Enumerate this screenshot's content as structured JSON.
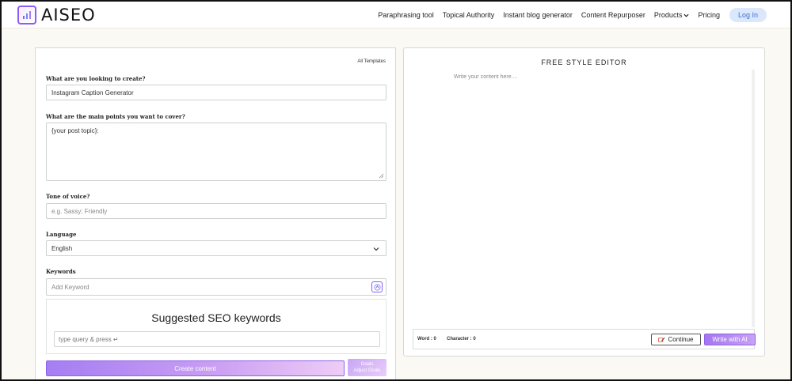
{
  "header": {
    "logo_text": "AISEO",
    "nav": [
      "Paraphrasing tool",
      "Topical Authority",
      "Instant blog generator",
      "Content Repurposer",
      "Products",
      "Pricing"
    ],
    "login_label": "Log In"
  },
  "form": {
    "all_templates": "All Templates",
    "create_label": "What are you looking to create?",
    "create_value": "Instagram Caption Generator",
    "points_label": "What are the main points you want to cover?",
    "points_value": "{your post topic}:",
    "tone_label": "Tone of voice?",
    "tone_placeholder": "e.g. Sassy; Friendly",
    "language_label": "Language",
    "language_value": "English",
    "keywords_label": "Keywords",
    "keywords_placeholder": "Add Keyword",
    "seo_title": "Suggested SEO keywords",
    "seo_placeholder": "type query & press ↵",
    "create_button": "Create content",
    "goals_line1": "Goals",
    "goals_line2": "Adjust Goals"
  },
  "editor": {
    "title": "FREE STYLE EDITOR",
    "placeholder": "Write your content here....",
    "word_label": "Word : 0",
    "char_label": "Character : 0",
    "continue_label": "Continue",
    "write_label": "Write with AI"
  },
  "colors": {
    "accent": "#8b5cf6",
    "login_bg": "#dbe8fb",
    "login_text": "#3b6fd8"
  }
}
